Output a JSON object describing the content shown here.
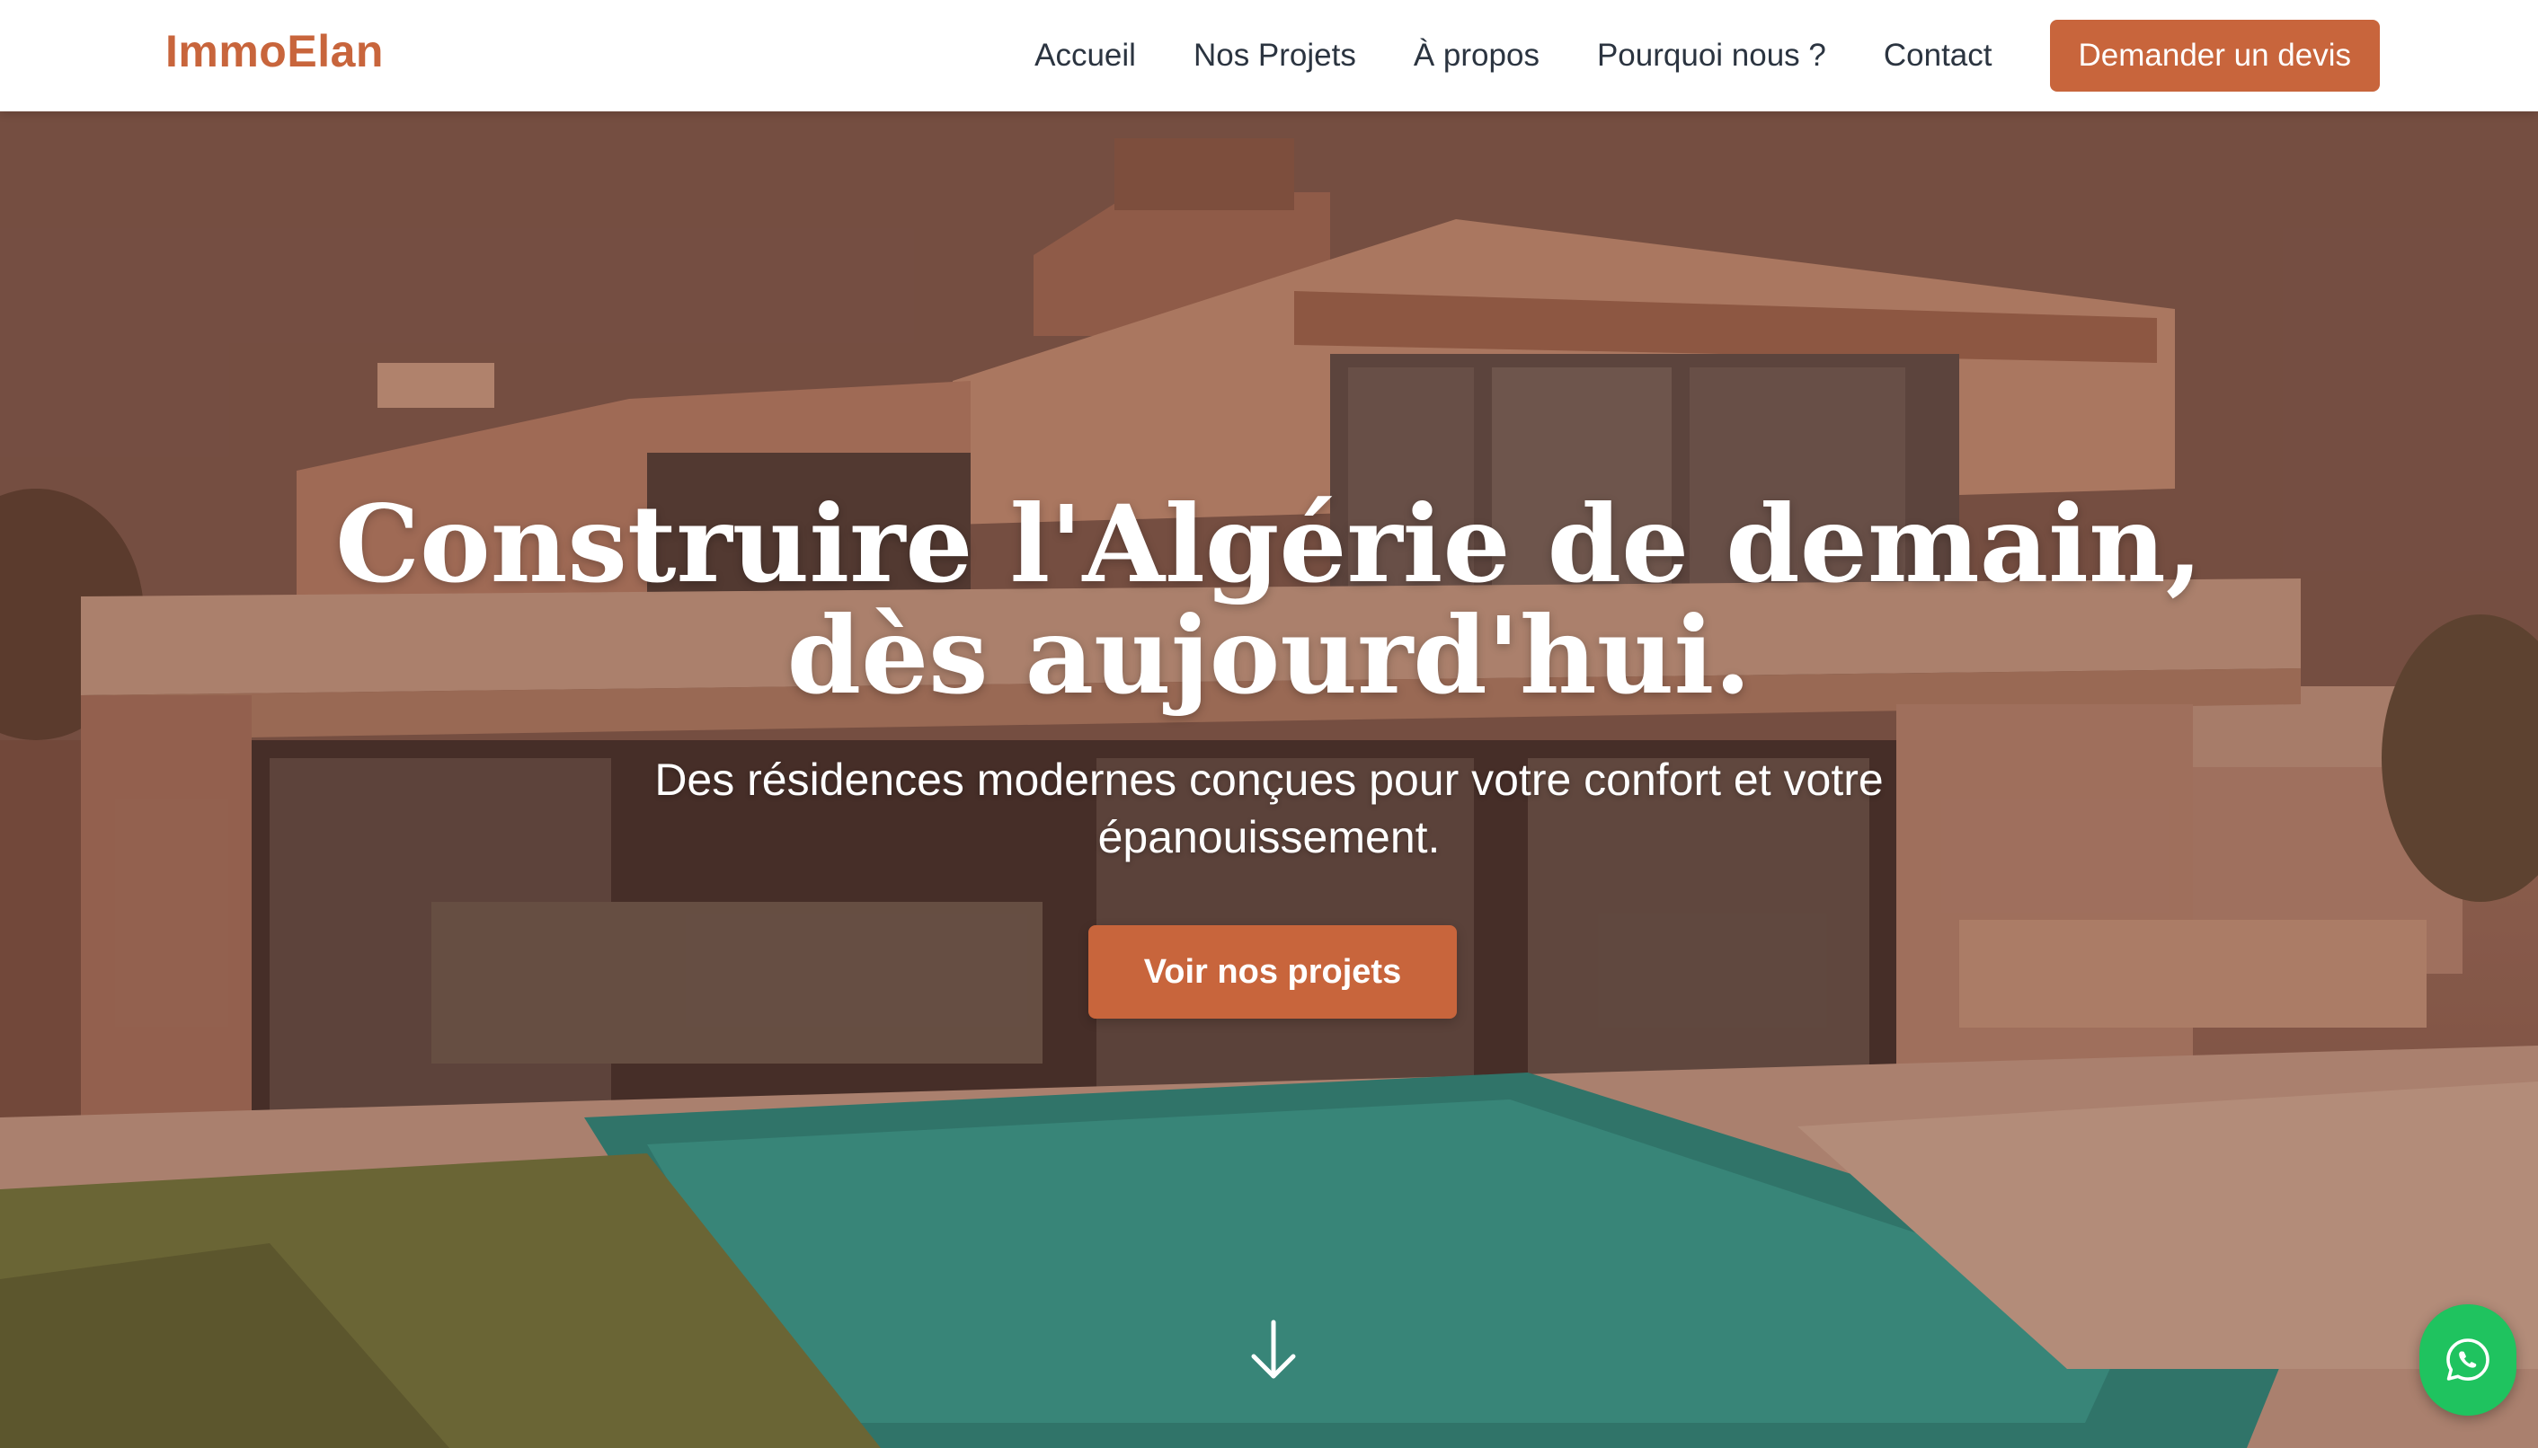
{
  "brand": {
    "name": "ImmoElan"
  },
  "nav": {
    "items": [
      {
        "label": "Accueil"
      },
      {
        "label": "Nos Projets"
      },
      {
        "label": "À propos"
      },
      {
        "label": "Pourquoi nous ?"
      },
      {
        "label": "Contact"
      }
    ],
    "cta_label": "Demander un devis"
  },
  "hero": {
    "title": "Construire l'Algérie de demain, dès aujourd'hui.",
    "subtitle": "Des résidences modernes conçues pour votre confort et votre épanouissement.",
    "cta_label": "Voir nos projets",
    "background": "modern-villa-with-pool-photo"
  },
  "icons": {
    "scroll": "arrow-down-icon",
    "whatsapp": "whatsapp-icon"
  },
  "colors": {
    "accent": "#c8653c",
    "nav_text": "#2b3440",
    "whatsapp": "#1fc35f",
    "hero_text": "#ffffff"
  }
}
